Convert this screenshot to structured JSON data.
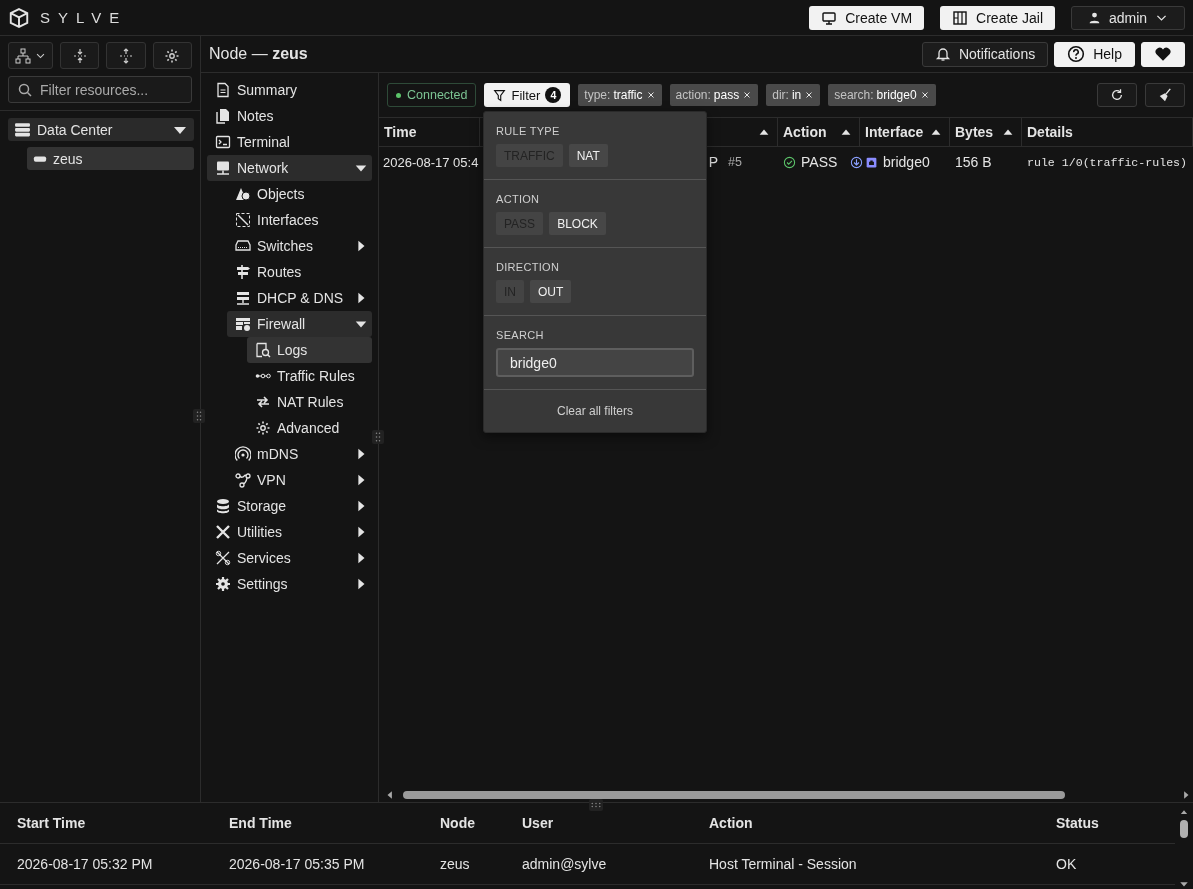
{
  "app": {
    "name": "SYLVE"
  },
  "top_actions": [
    {
      "kind": "vm",
      "label": "Create VM"
    },
    {
      "kind": "jail",
      "label": "Create Jail"
    }
  ],
  "user_menu": {
    "label": "admin"
  },
  "resource_panel": {
    "filter_placeholder": "Filter resources...",
    "tree": [
      {
        "label": "Data Center",
        "expanded": true,
        "children": [
          {
            "label": "zeus",
            "selected": true
          }
        ]
      }
    ]
  },
  "page_title": "Node — **zeus**",
  "header_buttons": [
    {
      "kind": "notifications",
      "label": "Notifications"
    },
    {
      "kind": "help",
      "label": "Help"
    },
    {
      "kind": "favorite"
    }
  ],
  "nav": [
    {
      "label": "Summary",
      "selected": false
    },
    {
      "label": "Notes",
      "selected": false
    },
    {
      "label": "Terminal",
      "selected": false
    },
    {
      "label": "Network",
      "expanded": true,
      "children": [
        {
          "label": "Objects",
          "selected": false
        },
        {
          "label": "Interfaces",
          "selected": false
        },
        {
          "label": "Switches",
          "selected": false,
          "expanded": false
        },
        {
          "label": "Routes",
          "selected": false
        },
        {
          "label": "DHCP & DNS",
          "selected": false,
          "expanded": false
        },
        {
          "label": "Firewall",
          "expanded": true,
          "children": [
            {
              "label": "Logs",
              "selected": true
            },
            {
              "label": "Traffic Rules",
              "selected": false
            },
            {
              "label": "NAT Rules",
              "selected": false
            },
            {
              "label": "Advanced",
              "selected": false
            }
          ]
        },
        {
          "label": "mDNS",
          "selected": false,
          "expanded": false
        },
        {
          "label": "VPN",
          "selected": false,
          "expanded": false
        }
      ]
    },
    {
      "label": "Storage",
      "selected": false,
      "expanded": false
    },
    {
      "label": "Utilities",
      "selected": false,
      "expanded": false
    },
    {
      "label": "Services",
      "selected": false,
      "expanded": false
    },
    {
      "label": "Settings",
      "selected": false,
      "expanded": false
    }
  ],
  "toolbar": {
    "status": {
      "label": "Connected",
      "connected": true
    },
    "filter": {
      "label": "Filter",
      "count": "4",
      "open": true
    },
    "chips": [
      {
        "key": "type:",
        "value": "traffic"
      },
      {
        "key": "action:",
        "value": "pass"
      },
      {
        "key": "dir:",
        "value": "in"
      },
      {
        "key": "search:",
        "value": "bridge0"
      }
    ]
  },
  "table": {
    "columns": [
      {
        "label": "Time",
        "sortable": false
      },
      {
        "sortable": true
      },
      {
        "label": "Action",
        "sortable": true
      },
      {
        "label": "Interface",
        "sortable": true
      },
      {
        "label": "Bytes",
        "sortable": true
      },
      {
        "label": "Details",
        "sortable": false
      }
    ],
    "rows": [
      {
        "time": "2026-08-17 05:4",
        "column_2": "P",
        "rule_number": "#5",
        "action": "PASS",
        "inbound": true,
        "interface": "bridge0",
        "bytes": "156 B",
        "details": "rule 1/0(traffic-rules)"
      }
    ]
  },
  "filter_menu": {
    "sections": [
      {
        "title": "RULE TYPE",
        "options": [
          {
            "label": "TRAFFIC",
            "selected": true
          },
          {
            "label": "NAT",
            "selected": false
          }
        ]
      },
      {
        "title": "ACTION",
        "options": [
          {
            "label": "PASS",
            "selected": true
          },
          {
            "label": "BLOCK",
            "selected": false
          }
        ]
      },
      {
        "title": "DIRECTION",
        "options": [
          {
            "label": "IN",
            "selected": true
          },
          {
            "label": "OUT",
            "selected": false
          }
        ]
      }
    ],
    "search": {
      "title": "SEARCH",
      "value": "bridge0"
    },
    "clear": "Clear all filters"
  },
  "audit_table": {
    "columns": [
      "Start Time",
      "End Time",
      "Node",
      "User",
      "Action",
      "Status"
    ],
    "rows": [
      [
        "2026-08-17 05:32 PM",
        "2026-08-17 05:35 PM",
        "zeus",
        "admin@sylve",
        "Host Terminal - Session",
        "OK"
      ]
    ]
  }
}
